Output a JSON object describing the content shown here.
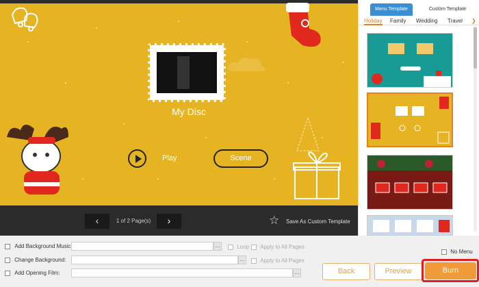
{
  "preview": {
    "disc_title": "My Disc",
    "play_label": "Play",
    "scene_label": "Scene",
    "frame_caption": "",
    "background_color": "#e6b323"
  },
  "navigation": {
    "page_indicator": "1 of 2 Page(s)",
    "save_template_label": "Save As Custom Template"
  },
  "template_panel": {
    "tabs": [
      "Menu Template",
      "Custom Template"
    ],
    "active_tab": "Menu Template",
    "categories": [
      "Holiday",
      "Family",
      "Wedding",
      "Travel"
    ],
    "active_category": "Holiday",
    "accent_color": "#e67e22"
  },
  "controls": {
    "bg_music_label": "Add Background Music:",
    "loop_label": "Loop",
    "apply_all_label": "Apply to All Pages",
    "change_bg_label": "Change Background:",
    "apply_all_label2": "Apply to All Pages",
    "opening_film_label": "Add Opening Film:",
    "browse_dots": "...",
    "no_menu_label": "No Menu"
  },
  "buttons": {
    "back": "Back",
    "preview": "Preview",
    "burn": "Burn"
  }
}
